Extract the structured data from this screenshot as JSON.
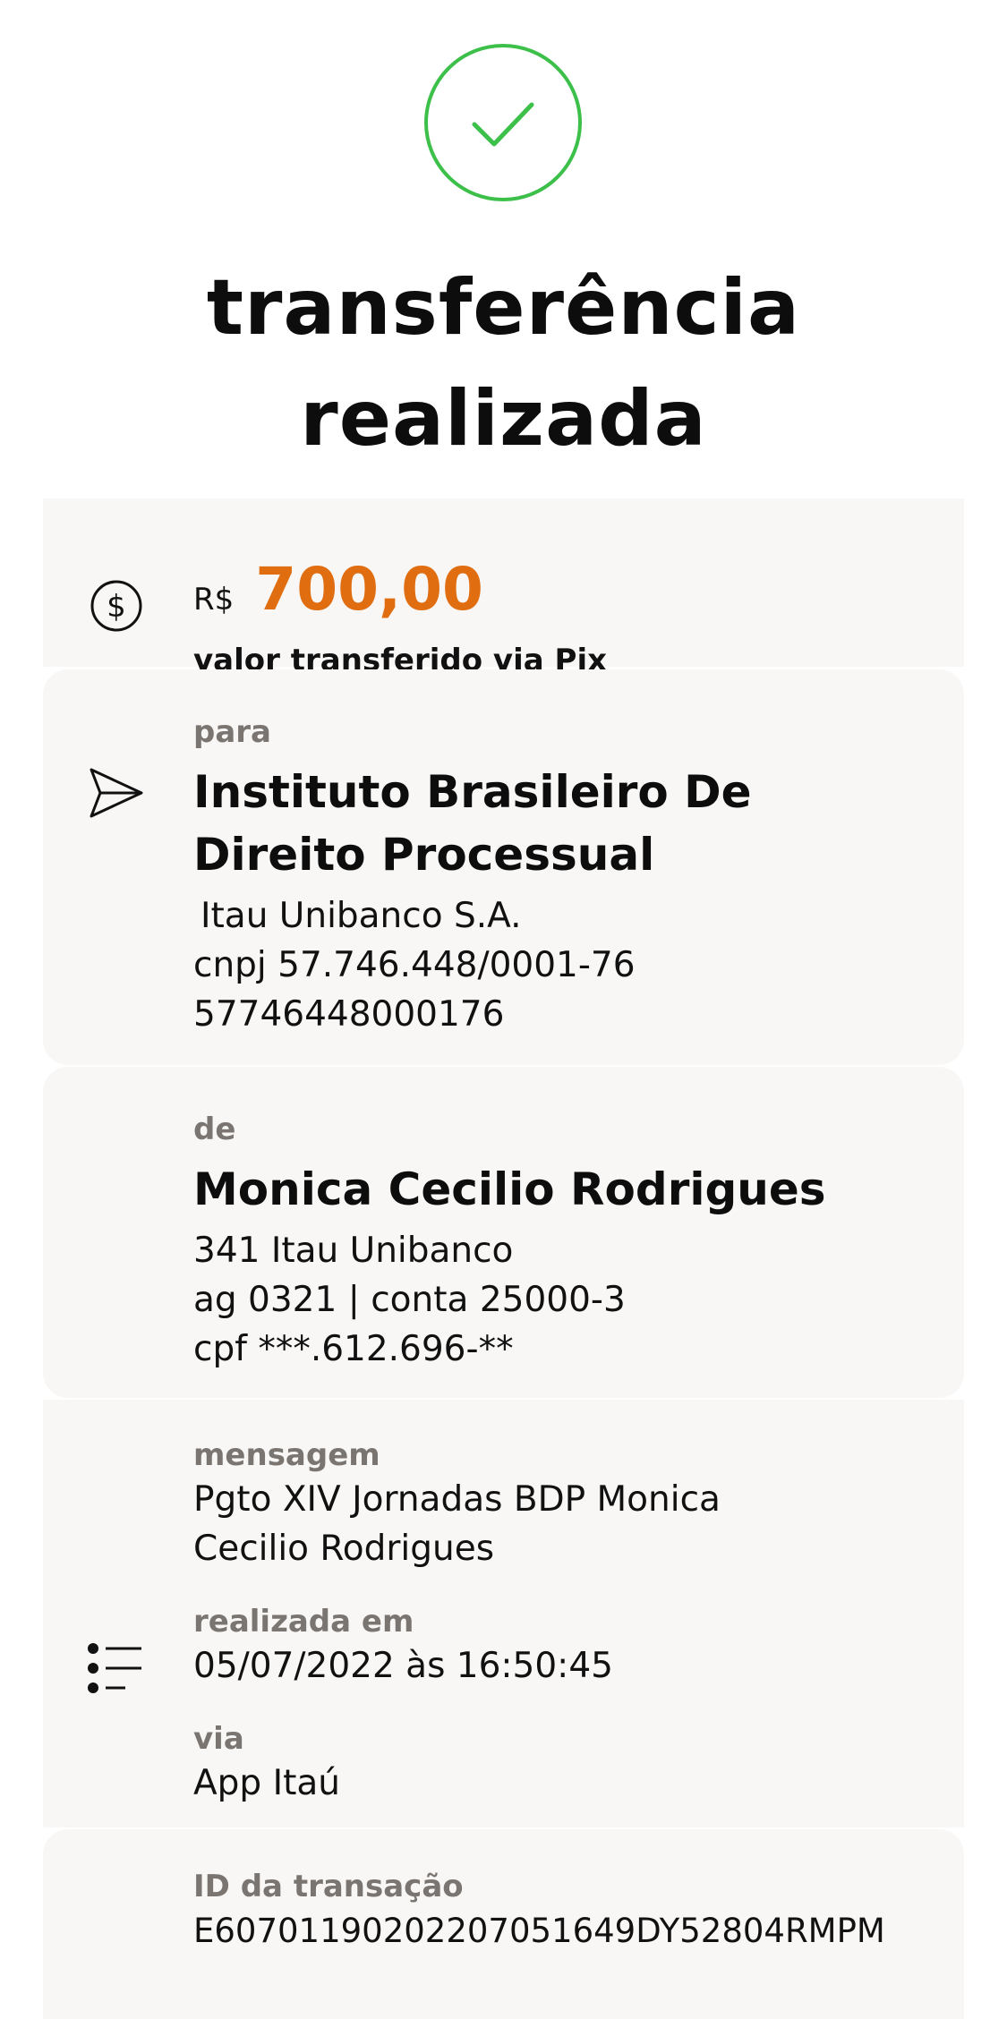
{
  "header": {
    "title_line1": "transferência",
    "title_line2": "realizada"
  },
  "amount": {
    "currency": "R$",
    "value": "700,00",
    "caption": "valor transferido via Pix",
    "color": "#e06d10"
  },
  "recipient": {
    "label": "para",
    "name": "Instituto Brasileiro De Direito Processual",
    "bank": "Itau Unibanco S.A.",
    "document": "cnpj 57.746.448/0001-76",
    "key": "57746448000176"
  },
  "sender": {
    "label": "de",
    "name": "Monica Cecilio Rodrigues",
    "bank": "341 Itau Unibanco",
    "account": "ag 0321 | conta 25000-3",
    "document": "cpf ***.612.696-**"
  },
  "details": {
    "message_label": "mensagem",
    "message_line1": "Pgto XIV Jornadas BDP  Monica",
    "message_line2": "Cecilio Rodrigues",
    "date_label": "realizada em",
    "date_value": "05/07/2022 às 16:50:45",
    "via_label": "via",
    "via_value": "App Itaú"
  },
  "transaction": {
    "id_label": "ID da transação",
    "id_value": "E60701190202207051649DY52804RMPM"
  },
  "icons": {
    "success": "check-circle-icon",
    "amount": "dollar-circle-icon",
    "recipient": "send-icon",
    "details": "list-icon"
  },
  "colors": {
    "success": "#3cc04a",
    "accent": "#e06d10",
    "card_bg": "#f8f7f5"
  }
}
